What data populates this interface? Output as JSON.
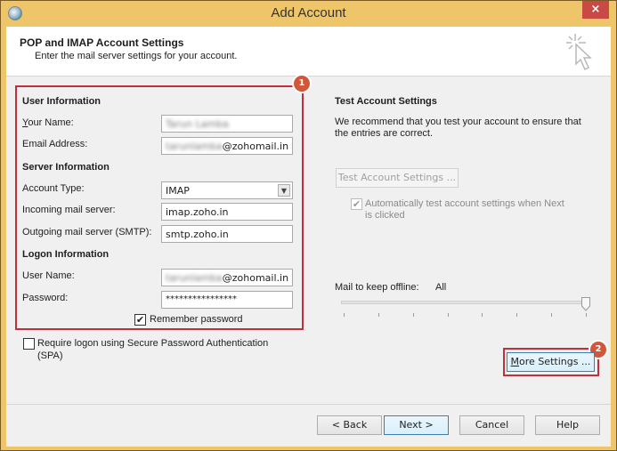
{
  "window": {
    "title": "Add Account",
    "close_label": "×"
  },
  "header": {
    "title": "POP and IMAP Account Settings",
    "subtitle": "Enter the mail server settings for your account."
  },
  "user_information": {
    "heading": "User Information",
    "your_name_label": "Your Name:",
    "your_name_value": "Tarun Lamba",
    "email_label": "Email Address:",
    "email_value_blurred": "tarunlamba",
    "email_value_domain": "@zohomail.in"
  },
  "server_information": {
    "heading": "Server Information",
    "account_type_label": "Account Type:",
    "account_type_value": "IMAP",
    "incoming_label": "Incoming mail server:",
    "incoming_value": "imap.zoho.in",
    "outgoing_label": "Outgoing mail server (SMTP):",
    "outgoing_value": "smtp.zoho.in"
  },
  "logon_information": {
    "heading": "Logon Information",
    "username_label": "User Name:",
    "username_value_blurred": "tarunlamba",
    "username_value_domain": "@zohomail.in",
    "password_label": "Password:",
    "password_value": "****************",
    "remember_label": "Remember password",
    "remember_checked": true,
    "spa_label_line1": "Require logon using Secure Password Authentication",
    "spa_label_line2": "(SPA)",
    "spa_checked": false
  },
  "test_settings": {
    "heading": "Test Account Settings",
    "description_line1": "We recommend that you test your account to ensure that",
    "description_line2": "the entries are correct.",
    "test_button_label": "Test Account Settings ...",
    "auto_test_line1": "Automatically test account settings when Next",
    "auto_test_line2": "is clicked",
    "auto_test_checked": true
  },
  "offline": {
    "label": "Mail to keep offline:",
    "value": "All",
    "slider_position": 1.0,
    "tick_count": 8
  },
  "annotations": {
    "badge1": "1",
    "badge2": "2",
    "highlight_color": "#c0303c",
    "badge_color": "#d0573a"
  },
  "buttons": {
    "more_settings": "More Settings ...",
    "back": "< Back",
    "next": "Next >",
    "cancel": "Cancel",
    "help": "Help"
  }
}
